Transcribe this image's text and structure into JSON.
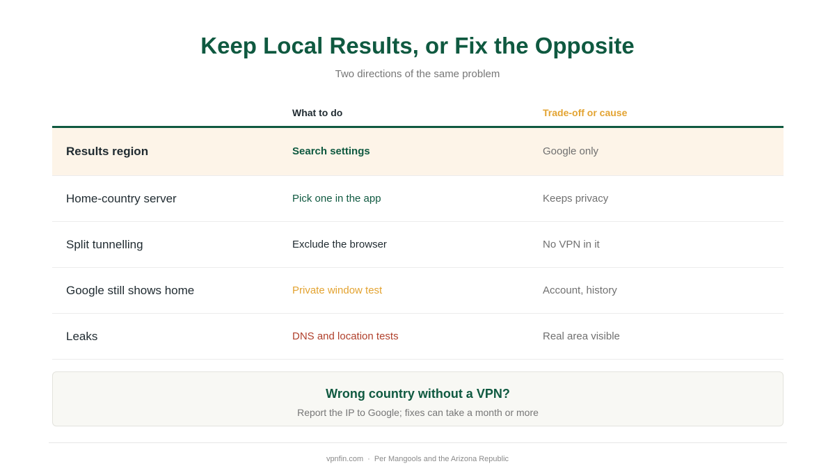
{
  "header": {
    "title": "Keep Local Results, or Fix the Opposite",
    "subtitle": "Two directions of the same problem"
  },
  "table": {
    "columns": [
      "",
      "What to do",
      "Trade-off or cause"
    ],
    "rows": [
      {
        "label": "Results region",
        "action": "Search settings",
        "note": "Google only",
        "action_color": "#0f5940",
        "highlighted": true
      },
      {
        "label": "Home-country server",
        "action": "Pick one in the app",
        "note": "Keeps privacy",
        "action_color": "#0f5940",
        "highlighted": false
      },
      {
        "label": "Split tunnelling",
        "action": "Exclude the browser",
        "note": "No VPN in it",
        "action_color": "#1f2a30",
        "highlighted": false
      },
      {
        "label": "Google still shows home",
        "action": "Private window test",
        "note": "Account, history",
        "action_color": "#e3a331",
        "highlighted": false
      },
      {
        "label": "Leaks",
        "action": "DNS and location tests",
        "note": "Real area visible",
        "action_color": "#b0402c",
        "highlighted": false
      }
    ]
  },
  "callout": {
    "title": "Wrong country without a VPN?",
    "text": "Report the IP to Google; fixes can take a month or more"
  },
  "footer": {
    "site": "vpnfin.com",
    "separator": "·",
    "source": "Per Mangools and the Arizona Republic"
  },
  "colors": {
    "accent": "#0f5940",
    "highlight_bg": "#fdf4e8",
    "gold": "#e3a331",
    "red": "#b0402c"
  }
}
